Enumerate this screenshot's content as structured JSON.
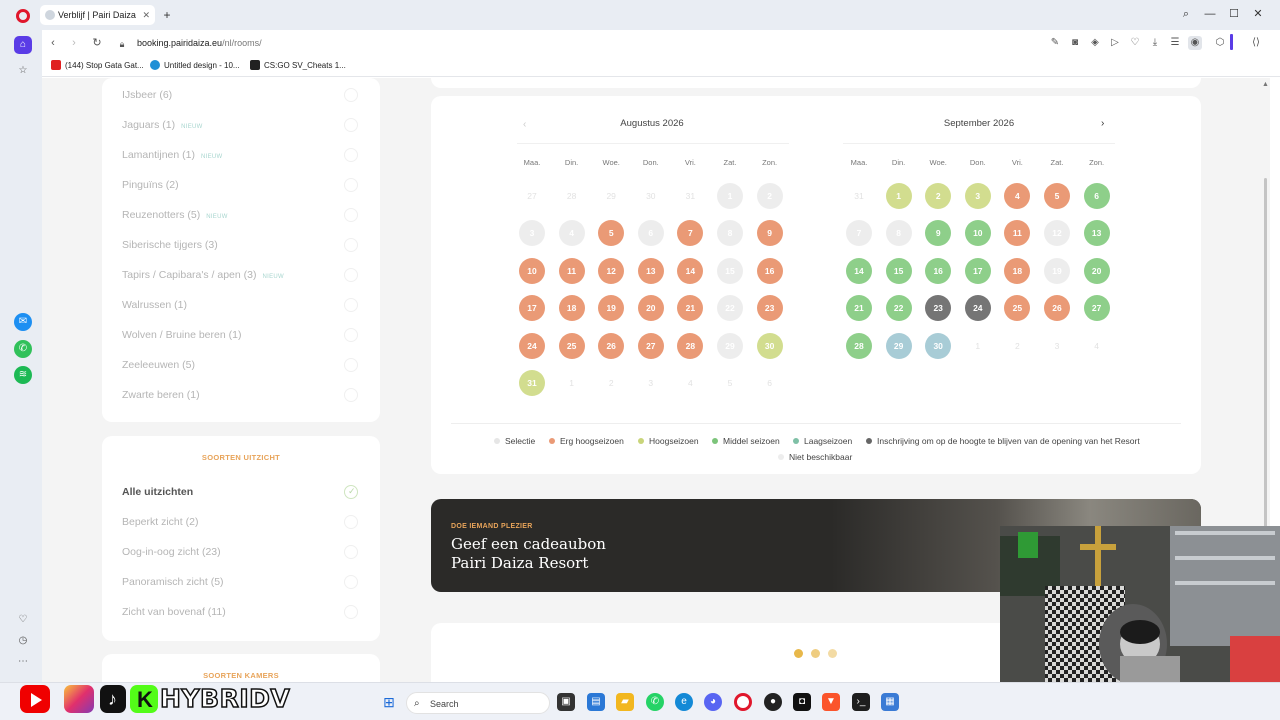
{
  "browser": {
    "tab_title": "Verblijf | Pairi Daiza",
    "new_tab": "+",
    "url_host": "booking.pairidaiza.eu",
    "url_path": "/nl/rooms/",
    "bookmarks": [
      {
        "label": "(144) Stop Gata Gat...",
        "icon": "youtube-icon",
        "color": "#e02020"
      },
      {
        "label": "Untitled design - 10...",
        "icon": "canva-icon",
        "color": "#1f8fd6"
      },
      {
        "label": "CS:GO SV_Cheats 1...",
        "icon": "steam-icon",
        "color": "#222222"
      }
    ]
  },
  "filters": {
    "room_items": [
      {
        "label": "IJsbeer (6)",
        "badge": ""
      },
      {
        "label": "Jaguars (1)",
        "badge": "NIEUW"
      },
      {
        "label": "Lamantijnen (1)",
        "badge": "NIEUW"
      },
      {
        "label": "Pinguïns (2)",
        "badge": ""
      },
      {
        "label": "Reuzenotters (5)",
        "badge": "NIEUW"
      },
      {
        "label": "Siberische tijgers (3)",
        "badge": ""
      },
      {
        "label": "Tapirs / Capibara's / apen (3)",
        "badge": "NIEUW"
      },
      {
        "label": "Walrussen (1)",
        "badge": ""
      },
      {
        "label": "Wolven / Bruine beren (1)",
        "badge": ""
      },
      {
        "label": "Zeeleeuwen (5)",
        "badge": ""
      },
      {
        "label": "Zwarte beren (1)",
        "badge": ""
      }
    ],
    "view_title": "SOORTEN UITZICHT",
    "view_items": [
      {
        "label": "Alle uitzichten",
        "active": true
      },
      {
        "label": "Beperkt zicht (2)",
        "active": false
      },
      {
        "label": "Oog-in-oog zicht (23)",
        "active": false
      },
      {
        "label": "Panoramisch zicht (5)",
        "active": false
      },
      {
        "label": "Zicht van bovenaf (11)",
        "active": false
      }
    ],
    "rooms_title": "SOORTEN KAMERS"
  },
  "calendar": {
    "prev_arrow": "‹",
    "next_arrow": "›",
    "weekdays": [
      "Maa.",
      "Din.",
      "Woe.",
      "Don.",
      "Vri.",
      "Zat.",
      "Zon."
    ],
    "colors": {
      "erg": "#ea9a76",
      "hoog": "#d2dd8f",
      "middel": "#8ecf8a",
      "laag": "#a8ccd6",
      "inschrijving": "#757575",
      "niet": "#ededed",
      "selectie": "#e6e6e6"
    },
    "months": [
      {
        "title": "Augustus 2026",
        "weeks": [
          [
            [
              "27",
              "out"
            ],
            [
              "28",
              "out"
            ],
            [
              "29",
              "out"
            ],
            [
              "30",
              "out"
            ],
            [
              "31",
              "out"
            ],
            [
              "1",
              "niet"
            ],
            [
              "2",
              "niet"
            ]
          ],
          [
            [
              "3",
              "niet"
            ],
            [
              "4",
              "niet"
            ],
            [
              "5",
              "erg"
            ],
            [
              "6",
              "niet"
            ],
            [
              "7",
              "erg"
            ],
            [
              "8",
              "niet"
            ],
            [
              "9",
              "erg"
            ]
          ],
          [
            [
              "10",
              "erg"
            ],
            [
              "11",
              "erg"
            ],
            [
              "12",
              "erg"
            ],
            [
              "13",
              "erg"
            ],
            [
              "14",
              "erg"
            ],
            [
              "15",
              "niet"
            ],
            [
              "16",
              "erg"
            ]
          ],
          [
            [
              "17",
              "erg"
            ],
            [
              "18",
              "erg"
            ],
            [
              "19",
              "erg"
            ],
            [
              "20",
              "erg"
            ],
            [
              "21",
              "erg"
            ],
            [
              "22",
              "niet"
            ],
            [
              "23",
              "erg"
            ]
          ],
          [
            [
              "24",
              "erg"
            ],
            [
              "25",
              "erg"
            ],
            [
              "26",
              "erg"
            ],
            [
              "27",
              "erg"
            ],
            [
              "28",
              "erg"
            ],
            [
              "29",
              "niet"
            ],
            [
              "30",
              "hoog"
            ]
          ],
          [
            [
              "31",
              "hoog"
            ],
            [
              "1",
              "out"
            ],
            [
              "2",
              "out"
            ],
            [
              "3",
              "out"
            ],
            [
              "4",
              "out"
            ],
            [
              "5",
              "out"
            ],
            [
              "6",
              "out"
            ]
          ]
        ]
      },
      {
        "title": "September 2026",
        "weeks": [
          [
            [
              "31",
              "out"
            ],
            [
              "1",
              "hoog"
            ],
            [
              "2",
              "hoog"
            ],
            [
              "3",
              "hoog"
            ],
            [
              "4",
              "erg"
            ],
            [
              "5",
              "erg"
            ],
            [
              "6",
              "middel"
            ]
          ],
          [
            [
              "7",
              "niet"
            ],
            [
              "8",
              "niet"
            ],
            [
              "9",
              "middel"
            ],
            [
              "10",
              "middel"
            ],
            [
              "11",
              "erg"
            ],
            [
              "12",
              "niet"
            ],
            [
              "13",
              "middel"
            ]
          ],
          [
            [
              "14",
              "middel"
            ],
            [
              "15",
              "middel"
            ],
            [
              "16",
              "middel"
            ],
            [
              "17",
              "middel"
            ],
            [
              "18",
              "erg"
            ],
            [
              "19",
              "niet"
            ],
            [
              "20",
              "middel"
            ]
          ],
          [
            [
              "21",
              "middel"
            ],
            [
              "22",
              "middel"
            ],
            [
              "23",
              "inschrijving"
            ],
            [
              "24",
              "inschrijving"
            ],
            [
              "25",
              "erg"
            ],
            [
              "26",
              "erg"
            ],
            [
              "27",
              "middel"
            ]
          ],
          [
            [
              "28",
              "middel"
            ],
            [
              "29",
              "laag"
            ],
            [
              "30",
              "laag"
            ],
            [
              "1",
              "out"
            ],
            [
              "2",
              "out"
            ],
            [
              "3",
              "out"
            ],
            [
              "4",
              "out"
            ]
          ]
        ]
      }
    ],
    "legend": [
      {
        "label": "Selectie",
        "color": "#e6e6e6"
      },
      {
        "label": "Erg hoogseizoen",
        "color": "#ea9a76"
      },
      {
        "label": "Hoogseizoen",
        "color": "#c9d57a"
      },
      {
        "label": "Middel seizoen",
        "color": "#7cc47a"
      },
      {
        "label": "Laagseizoen",
        "color": "#7fc0a6"
      },
      {
        "label": "Inschrijving om op de hoogte te blijven van de opening van het Resort",
        "color": "#666666"
      },
      {
        "label": "Niet beschikbaar",
        "color": "#ededed"
      }
    ]
  },
  "gift": {
    "kicker": "DOE IEMAND PLEZIER",
    "title_line1": "Geef een cadeaubon",
    "title_line2": "Pairi Daiza Resort"
  },
  "taskbar": {
    "brand_text": "HYBRIDV",
    "search_placeholder": "Search"
  }
}
